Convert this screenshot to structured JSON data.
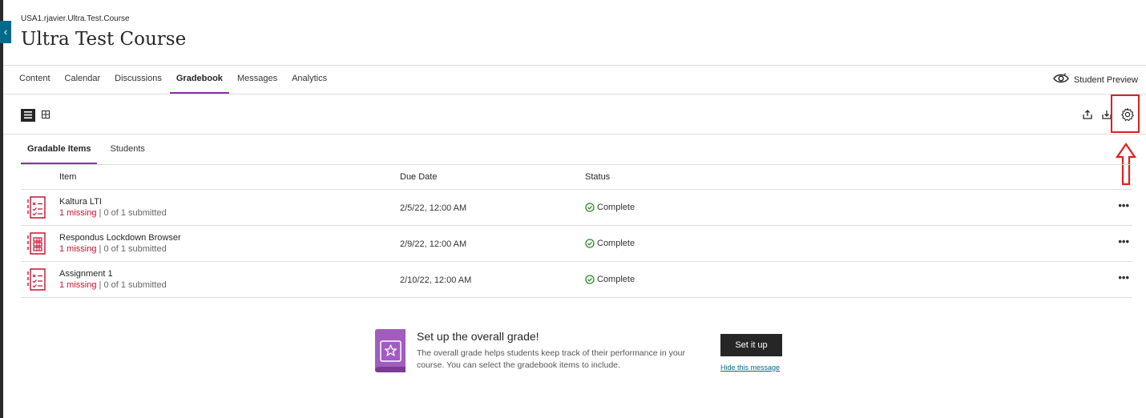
{
  "header": {
    "course_id": "USA1.rjavier.Ultra.Test.Course",
    "course_title": "Ultra Test Course",
    "back_icon": "chevron-left-icon"
  },
  "nav": {
    "tabs": [
      {
        "label": "Content"
      },
      {
        "label": "Calendar"
      },
      {
        "label": "Discussions"
      },
      {
        "label": "Gradebook",
        "active": true
      },
      {
        "label": "Messages"
      },
      {
        "label": "Analytics"
      }
    ],
    "student_preview_label": "Student Preview"
  },
  "toolbar": {
    "view_modes": [
      "list-view-icon",
      "grid-view-icon"
    ],
    "icons": [
      "upload-icon",
      "download-icon",
      "gear-icon"
    ]
  },
  "subtabs": [
    {
      "label": "Gradable Items",
      "active": true
    },
    {
      "label": "Students"
    }
  ],
  "table": {
    "headers": {
      "item": "Item",
      "due": "Due Date",
      "status": "Status"
    },
    "rows": [
      {
        "name": "Kaltura LTI",
        "missing": "1 missing",
        "submitted": "| 0 of 1 submitted",
        "due": "2/5/22, 12:00 AM",
        "status": "Complete",
        "icon": "assignment-icon"
      },
      {
        "name": "Respondus Lockdown Browser",
        "missing": "1 missing",
        "submitted": "| 0 of 1 submitted",
        "due": "2/9/22, 12:00 AM",
        "status": "Complete",
        "icon": "test-icon"
      },
      {
        "name": "Assignment 1",
        "missing": "1 missing",
        "submitted": "| 0 of 1 submitted",
        "due": "2/10/22, 12:00 AM",
        "status": "Complete",
        "icon": "assignment-icon"
      }
    ],
    "more_label": "•••"
  },
  "promo": {
    "title": "Set up the overall grade!",
    "text": "The overall grade helps students keep track of their performance in your course. You can select the gradebook items to include.",
    "button_label": "Set it up",
    "hide_label": "Hide this message"
  },
  "colors": {
    "accent": "#8f2ea8",
    "missing": "#c8102e",
    "complete": "#2a8a2a",
    "annotation": "#e02020"
  }
}
